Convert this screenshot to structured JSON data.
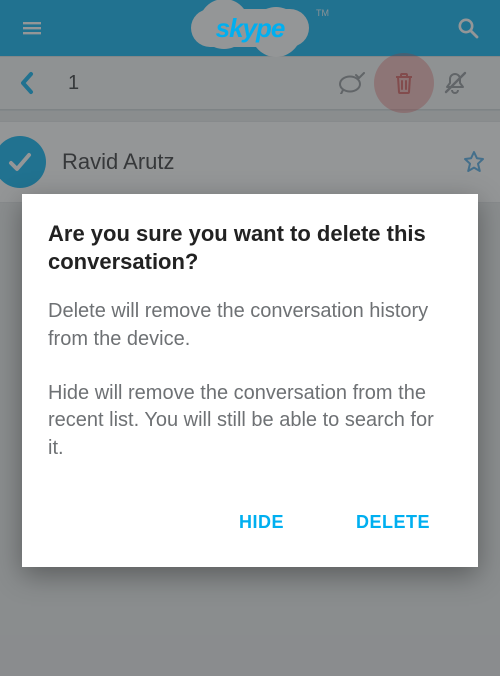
{
  "app_bar": {
    "logo_text": "skype",
    "logo_tm": "TM"
  },
  "sub_bar": {
    "selection_count": "1"
  },
  "conversation": {
    "name": "Ravid Arutz"
  },
  "dialog": {
    "title": "Are you sure you want to delete this conversation?",
    "body_delete": "Delete will remove the conversation history from the device.",
    "body_hide": "Hide will remove the conversation from the recent list. You will still be able to search for it.",
    "btn_hide": "HIDE",
    "btn_delete": "DELETE"
  }
}
